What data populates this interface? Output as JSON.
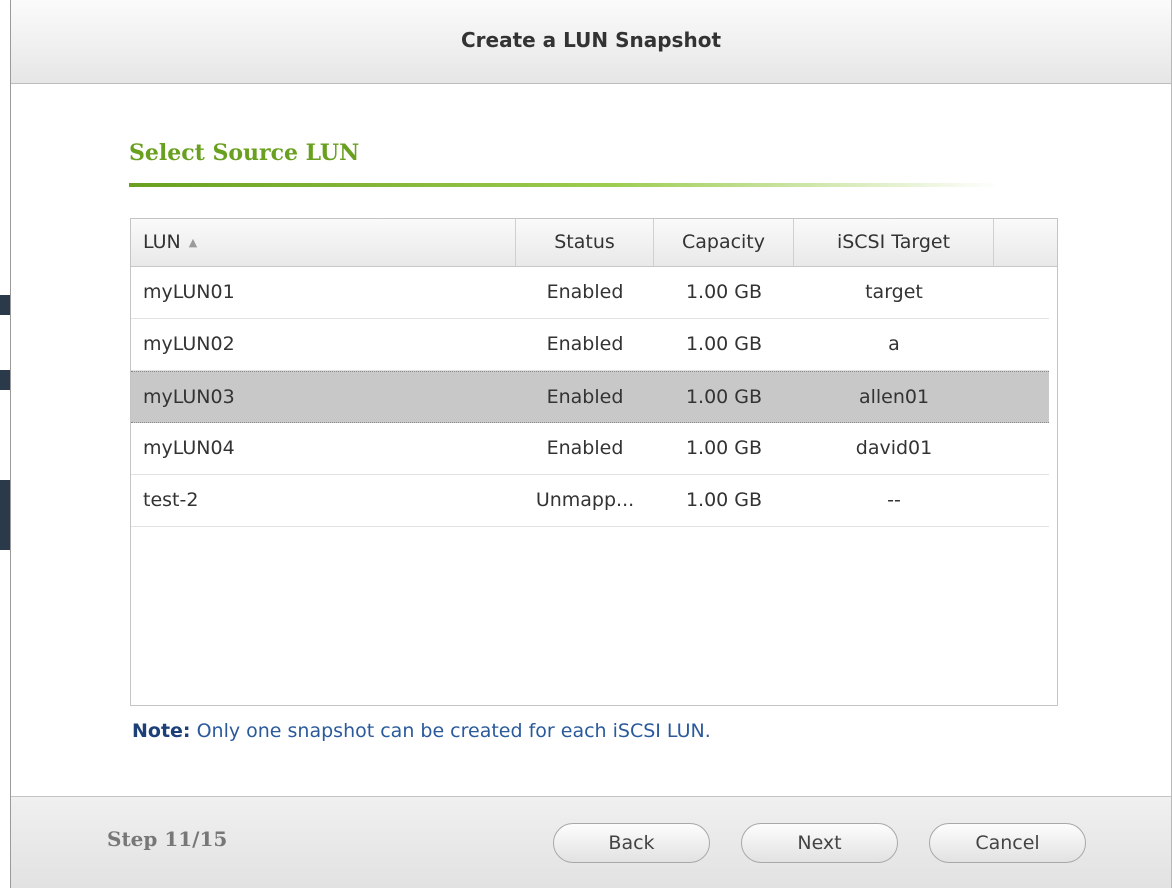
{
  "dialog": {
    "title": "Create a LUN Snapshot"
  },
  "section": {
    "title": "Select Source LUN"
  },
  "table": {
    "columns": {
      "lun": "LUN",
      "status": "Status",
      "capacity": "Capacity",
      "target": "iSCSI Target"
    },
    "sort": {
      "column": "LUN",
      "direction": "ascending",
      "icon": "sort-ascending-icon"
    },
    "rows": [
      {
        "lun": "myLUN01",
        "status": "Enabled",
        "capacity": "1.00 GB",
        "target": "target",
        "selected": false
      },
      {
        "lun": "myLUN02",
        "status": "Enabled",
        "capacity": "1.00 GB",
        "target": "a",
        "selected": false
      },
      {
        "lun": "myLUN03",
        "status": "Enabled",
        "capacity": "1.00 GB",
        "target": "allen01",
        "selected": true
      },
      {
        "lun": "myLUN04",
        "status": "Enabled",
        "capacity": "1.00 GB",
        "target": "david01",
        "selected": false
      },
      {
        "lun": "test-2",
        "status": "Unmapp...",
        "capacity": "1.00 GB",
        "target": "--",
        "selected": false
      }
    ]
  },
  "note": {
    "label": "Note:",
    "text": " Only one snapshot can be created for each iSCSI LUN."
  },
  "footer": {
    "step": "Step 11/15",
    "back_label": "Back",
    "next_label": "Next",
    "cancel_label": "Cancel"
  },
  "colors": {
    "section_title": "#6aa020",
    "selected_row": "#c8c8c8",
    "note_text": "#2a5a9c"
  }
}
